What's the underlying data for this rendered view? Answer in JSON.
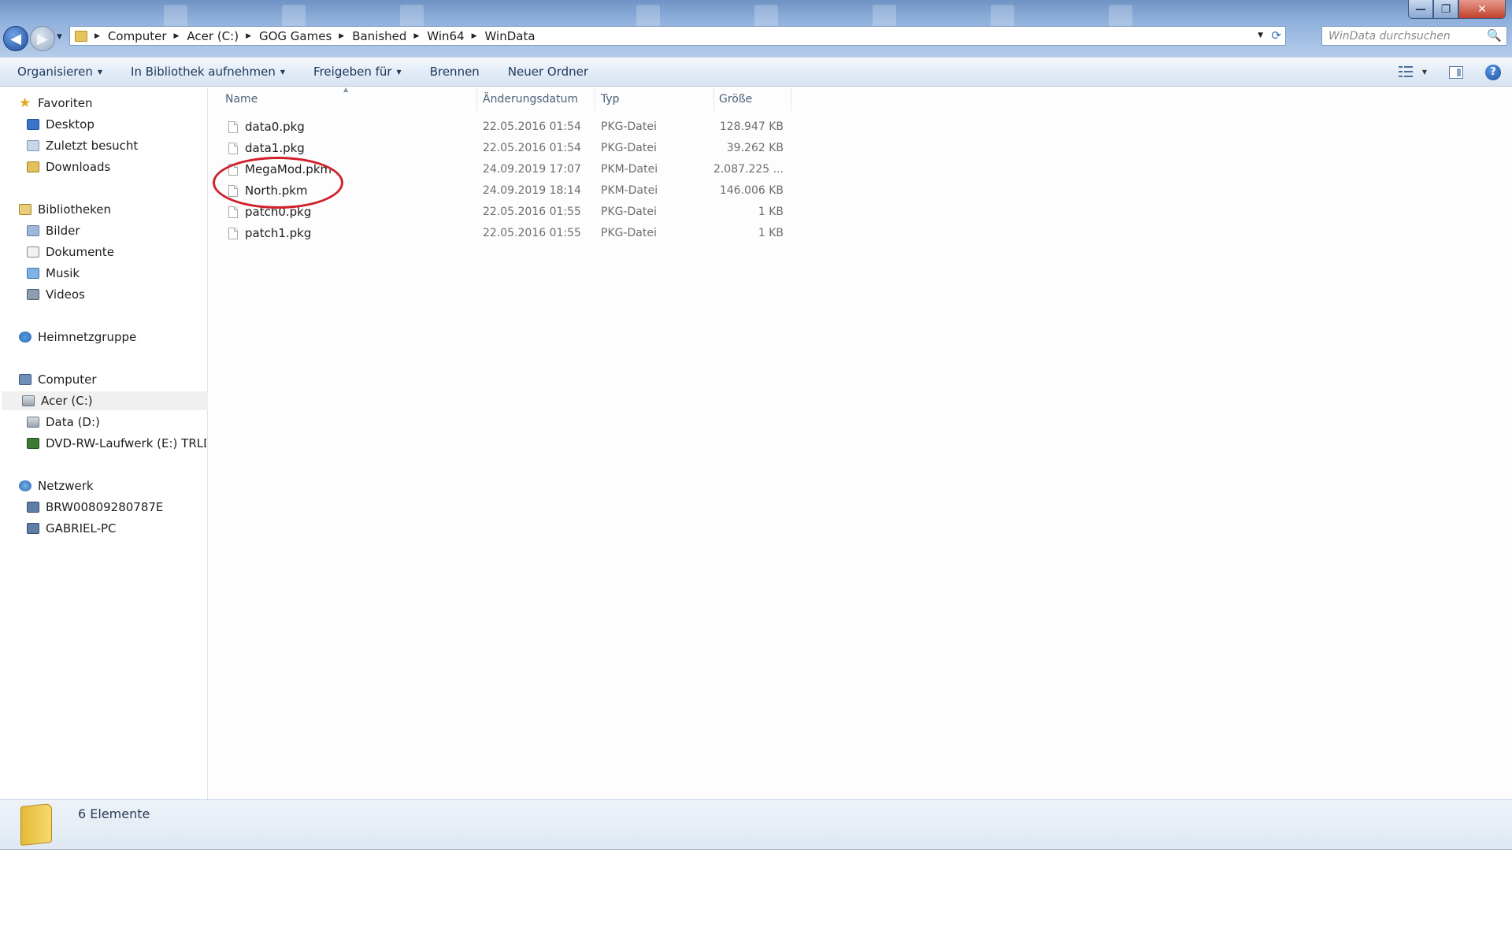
{
  "window": {
    "minimize_label": "—",
    "maximize_label": "❐",
    "close_label": "✕"
  },
  "navigation": {
    "back_label": "◀",
    "forward_label": "▶",
    "history_caret": "▼"
  },
  "address": {
    "breadcrumbs": [
      "Computer",
      "Acer (C:)",
      "GOG Games",
      "Banished",
      "Win64",
      "WinData"
    ],
    "separator": "▶",
    "dropdown_caret": "▼",
    "refresh_icon": "⟳"
  },
  "search": {
    "placeholder": "WinData durchsuchen",
    "icon": "🔍"
  },
  "commands": {
    "organize": "Organisieren",
    "include_library": "In Bibliothek aufnehmen",
    "share": "Freigeben für",
    "burn": "Brennen",
    "new_folder": "Neuer Ordner",
    "caret": "▼",
    "help": "?"
  },
  "sidebar": {
    "favorites": "Favoriten",
    "desktop": "Desktop",
    "recent": "Zuletzt besucht",
    "downloads": "Downloads",
    "libraries": "Bibliotheken",
    "pictures": "Bilder",
    "documents": "Dokumente",
    "music": "Musik",
    "videos": "Videos",
    "homegroup": "Heimnetzgruppe",
    "computer": "Computer",
    "drive_c": "Acer (C:)",
    "drive_d": "Data (D:)",
    "drive_e": "DVD-RW-Laufwerk (E:) TRLD_D",
    "network": "Netzwerk",
    "net_pc1": "BRW00809280787E",
    "net_pc2": "GABRIEL-PC",
    "star_icon": "★"
  },
  "columns": {
    "name": "Name",
    "date": "Änderungsdatum",
    "type": "Typ",
    "size": "Größe",
    "sort_arrow": "▲"
  },
  "files": [
    {
      "name": "data0.pkg",
      "date": "22.05.2016 01:54",
      "type": "PKG-Datei",
      "size": "128.947 KB"
    },
    {
      "name": "data1.pkg",
      "date": "22.05.2016 01:54",
      "type": "PKG-Datei",
      "size": "39.262 KB"
    },
    {
      "name": "MegaMod.pkm",
      "date": "24.09.2019 17:07",
      "type": "PKM-Datei",
      "size": "2.087.225 ..."
    },
    {
      "name": "North.pkm",
      "date": "24.09.2019 18:14",
      "type": "PKM-Datei",
      "size": "146.006 KB"
    },
    {
      "name": "patch0.pkg",
      "date": "22.05.2016 01:55",
      "type": "PKG-Datei",
      "size": "1 KB"
    },
    {
      "name": "patch1.pkg",
      "date": "22.05.2016 01:55",
      "type": "PKG-Datei",
      "size": "1 KB"
    }
  ],
  "details": {
    "count": "6 Elemente"
  },
  "colors": {
    "annotation": "#d0202a",
    "selected_bg": "#f0f0f0"
  }
}
